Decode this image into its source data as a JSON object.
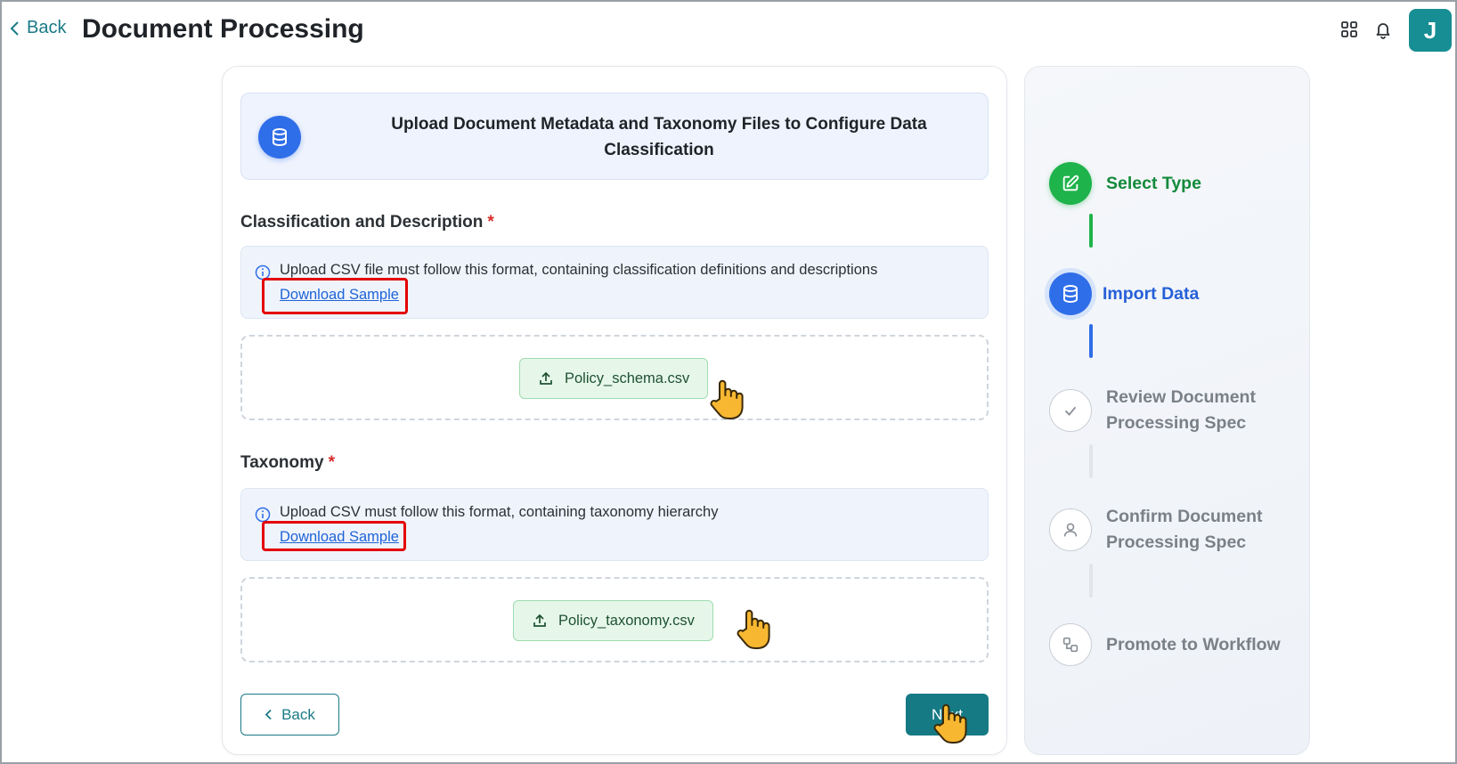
{
  "header": {
    "back_label": "Back",
    "title": "Document Processing",
    "avatar_initial": "J",
    "icons": [
      "apps-grid-icon",
      "bell-icon"
    ]
  },
  "banner": {
    "icon": "database-icon",
    "title": "Upload Document Metadata and Taxonomy Files to Configure Data Classification"
  },
  "classification": {
    "title": "Classification and Description",
    "required_mark": "*",
    "info_text": "Upload CSV file must follow this format, containing classification definitions and descriptions",
    "download_label": "Download Sample",
    "file_name": "Policy_schema.csv"
  },
  "taxonomy": {
    "title": "Taxonomy",
    "required_mark": "*",
    "info_text": "Upload CSV must follow this format, containing taxonomy hierarchy",
    "download_label": "Download Sample",
    "file_name": "Policy_taxonomy.csv"
  },
  "footer": {
    "back_label": "Back",
    "next_label": "Next"
  },
  "steps": [
    {
      "label": "Select Type",
      "status": "completed",
      "icon": "edit-icon"
    },
    {
      "label": "Import Data",
      "status": "active",
      "icon": "database-icon"
    },
    {
      "label": "Review Document Processing Spec",
      "status": "pending",
      "icon": "check-icon"
    },
    {
      "label": "Confirm Document Processing Spec",
      "status": "pending",
      "icon": "user-icon"
    },
    {
      "label": "Promote to Workflow",
      "status": "pending",
      "icon": "workflow-icon"
    }
  ],
  "colors": {
    "brand_teal": "#157a84",
    "step_completed": "#1fb34b",
    "step_active": "#2f6ee9",
    "highlight_red": "#e30000"
  }
}
